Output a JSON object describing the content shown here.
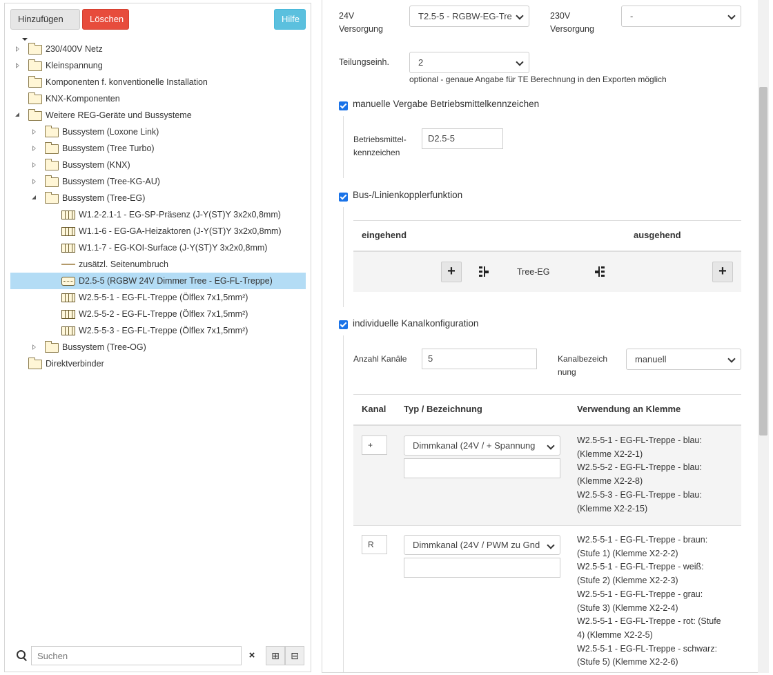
{
  "toolbar": {
    "add_label": "Hinzufügen",
    "delete_label": "Löschen",
    "help_label": "Hilfe"
  },
  "tree": {
    "items": [
      {
        "label": "230/400V Netz",
        "level": 0,
        "toggle": "collapsed",
        "icon": "folder"
      },
      {
        "label": "Kleinspannung",
        "level": 0,
        "toggle": "collapsed",
        "icon": "folder"
      },
      {
        "label": "Komponenten f. konventionelle Installation",
        "level": 0,
        "toggle": "none",
        "icon": "folder"
      },
      {
        "label": "KNX-Komponenten",
        "level": 0,
        "toggle": "none",
        "icon": "folder"
      },
      {
        "label": "Weitere REG-Geräte und Bussysteme",
        "level": 0,
        "toggle": "expanded",
        "icon": "folder"
      },
      {
        "label": "Bussystem (Loxone Link)",
        "level": 1,
        "toggle": "collapsed",
        "icon": "folder"
      },
      {
        "label": "Bussystem (Tree Turbo)",
        "level": 1,
        "toggle": "collapsed",
        "icon": "folder"
      },
      {
        "label": "Bussystem (KNX)",
        "level": 1,
        "toggle": "collapsed",
        "icon": "folder"
      },
      {
        "label": "Bussystem (Tree-KG-AU)",
        "level": 1,
        "toggle": "collapsed",
        "icon": "folder"
      },
      {
        "label": "Bussystem (Tree-EG)",
        "level": 1,
        "toggle": "expanded",
        "icon": "folder"
      },
      {
        "label": "W1.2-2.1-1 - EG-SP-Präsenz (J-Y(ST)Y 3x2x0,8mm)",
        "level": 2,
        "toggle": "none",
        "icon": "cable"
      },
      {
        "label": "W1.1-6 - EG-GA-Heizaktoren (J-Y(ST)Y 3x2x0,8mm)",
        "level": 2,
        "toggle": "none",
        "icon": "cable"
      },
      {
        "label": "W1.1-7 - EG-KOI-Surface (J-Y(ST)Y 3x2x0,8mm)",
        "level": 2,
        "toggle": "none",
        "icon": "cable"
      },
      {
        "label": "zusätzl. Seitenumbruch",
        "level": 2,
        "toggle": "none",
        "icon": "pagebreak"
      },
      {
        "label": "D2.5-5 (RGBW 24V Dimmer Tree - EG-FL-Treppe)",
        "level": 2,
        "toggle": "none",
        "icon": "device",
        "selected": true
      },
      {
        "label": "W2.5-5-1 - EG-FL-Treppe (Ölflex 7x1,5mm²)",
        "level": 2,
        "toggle": "none",
        "icon": "cable"
      },
      {
        "label": "W2.5-5-2 - EG-FL-Treppe (Ölflex 7x1,5mm²)",
        "level": 2,
        "toggle": "none",
        "icon": "cable"
      },
      {
        "label": "W2.5-5-3 - EG-FL-Treppe (Ölflex 7x1,5mm²)",
        "level": 2,
        "toggle": "none",
        "icon": "cable"
      },
      {
        "label": "Bussystem (Tree-OG)",
        "level": 1,
        "toggle": "collapsed",
        "icon": "folder"
      },
      {
        "label": "Direktverbinder",
        "level": 0,
        "toggle": "none",
        "icon": "folder"
      }
    ]
  },
  "search": {
    "placeholder": "Suchen",
    "clear_icon": "×",
    "expand_icon": "⊞",
    "collapse_icon": "⊟"
  },
  "form": {
    "v24_label": "24V\nVersorgung",
    "v24_value": "T2.5-5 - RGBW-EG-Tre",
    "v230_label": "230V\nVersorgung",
    "v230_value": "-",
    "te_label": "Teilungseinh.",
    "te_value": "2",
    "te_hint": "optional - genaue Angabe für TE Berechnung in den Exporten möglich",
    "manual_bmk_label": "manuelle Vergabe Betriebsmittelkennzeichen",
    "bmk_label": "Betriebsmittel-\nkennzeichen",
    "bmk_value": "D2.5-5",
    "bus_coupler_label": "Bus-/Linienkopplerfunktion",
    "incoming_header": "eingehend",
    "outgoing_header": "ausgehend",
    "bus_name": "Tree-EG",
    "channel_config_label": "individuelle Kanalkonfiguration",
    "channel_count_label": "Anzahl Kanäle",
    "channel_count_value": "5",
    "channel_naming_label": "Kanalbezeich\nnung",
    "channel_naming_value": "manuell"
  },
  "channel_table": {
    "headers": {
      "channel": "Kanal",
      "type": "Typ / Bezeichnung",
      "usage": "Verwendung an Klemme"
    },
    "rows": [
      {
        "channel": "+",
        "type": "Dimmkanal (24V / + Spannung",
        "name": "",
        "usage": [
          "W2.5-5-1 - EG-FL-Treppe - blau:",
          "(Klemme X2-2-1)",
          "W2.5-5-2 - EG-FL-Treppe - blau:",
          "(Klemme X2-2-8)",
          "W2.5-5-3 - EG-FL-Treppe - blau:",
          "(Klemme X2-2-15)"
        ]
      },
      {
        "channel": "R",
        "type": "Dimmkanal (24V / PWM zu Gnd",
        "name": "",
        "usage": [
          "W2.5-5-1 - EG-FL-Treppe - braun:",
          "(Stufe 1) (Klemme X2-2-2)",
          "W2.5-5-1 - EG-FL-Treppe - weiß:",
          "(Stufe 2) (Klemme X2-2-3)",
          "W2.5-5-1 - EG-FL-Treppe - grau:",
          "(Stufe 3) (Klemme X2-2-4)",
          "W2.5-5-1 - EG-FL-Treppe - rot: (Stufe",
          "4) (Klemme X2-2-5)",
          "W2.5-5-1 - EG-FL-Treppe - schwarz:",
          "(Stufe 5) (Klemme X2-2-6)"
        ]
      }
    ]
  }
}
